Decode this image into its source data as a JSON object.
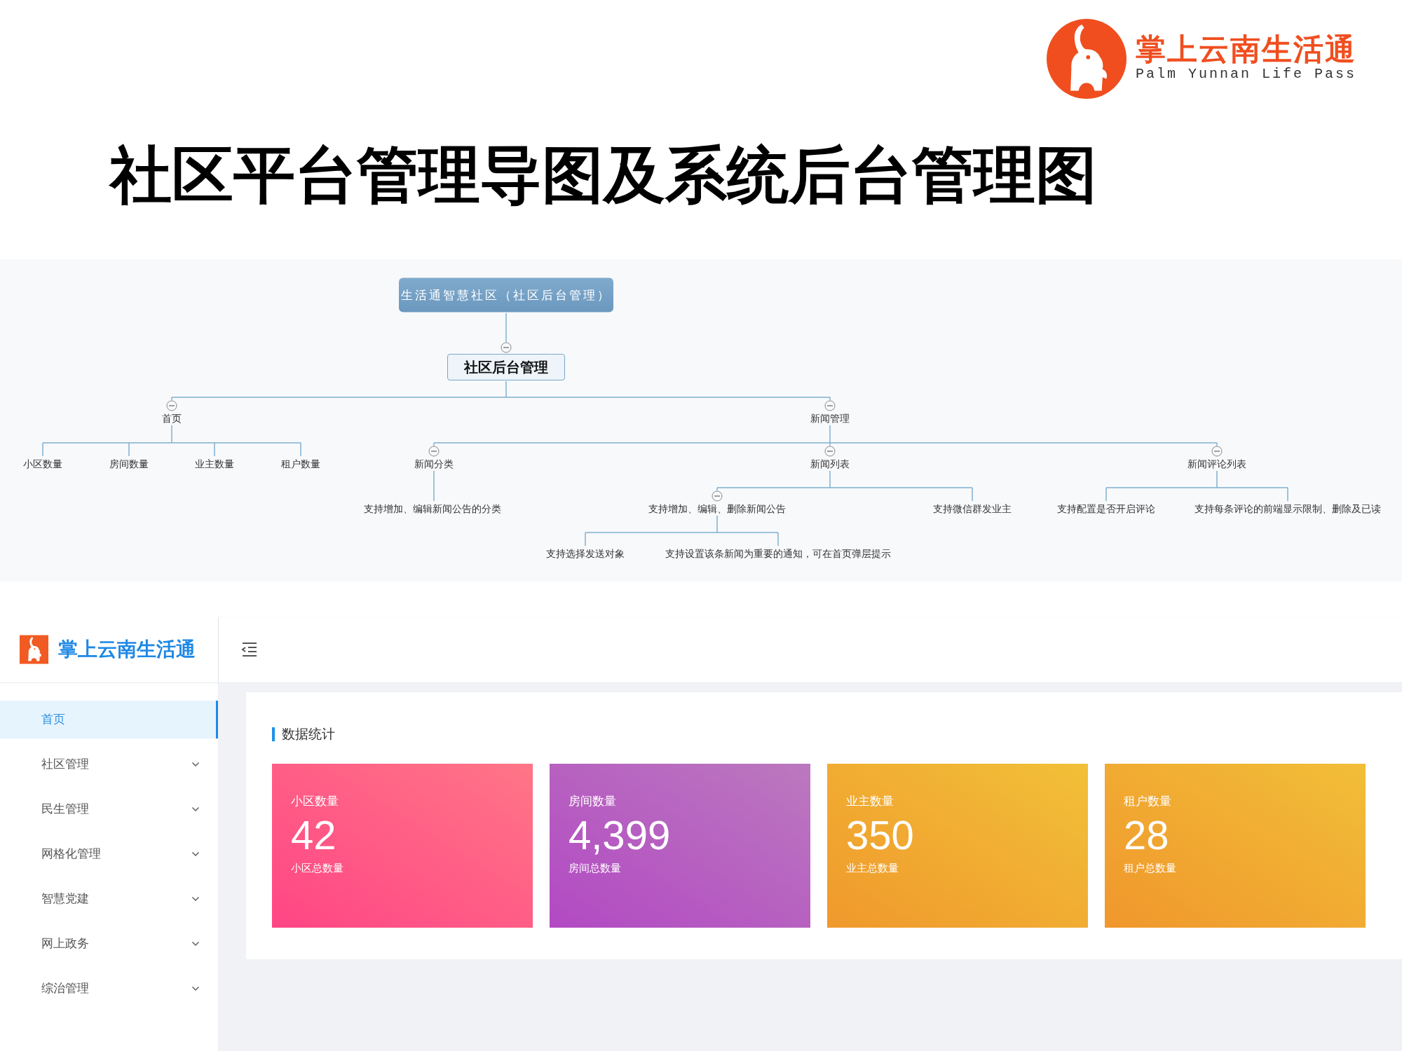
{
  "slide": {
    "title": "社区平台管理导图及系统后台管理图",
    "logo": {
      "name": "掌上云南生活通",
      "tagline": "Palm Yunnan Life Pass"
    }
  },
  "mind_map": {
    "root": {
      "label": "生活通智慧社区（社区后台管理）",
      "children": [
        {
          "label": "社区后台管理",
          "expanded": true,
          "children": [
            {
              "label": "首页",
              "expanded": true,
              "children": [
                {
                  "label": "小区数量"
                },
                {
                  "label": "房间数量"
                },
                {
                  "label": "业主数量"
                },
                {
                  "label": "租户数量"
                }
              ]
            },
            {
              "label": "新闻管理",
              "expanded": true,
              "children": [
                {
                  "label": "新闻分类",
                  "expanded": true,
                  "children": [
                    {
                      "label": "支持增加、编辑新闻公告的分类"
                    }
                  ]
                },
                {
                  "label": "新闻列表",
                  "expanded": true,
                  "children": [
                    {
                      "label": "支持增加、编辑、删除新闻公告",
                      "expanded": true,
                      "children": [
                        {
                          "label": "支持选择发送对象"
                        },
                        {
                          "label": "支持设置该条新闻为重要的通知，可在首页弹层提示"
                        }
                      ]
                    },
                    {
                      "label": "支持微信群发业主"
                    }
                  ]
                },
                {
                  "label": "新闻评论列表",
                  "expanded": true,
                  "children": [
                    {
                      "label": "支持配置是否开启评论"
                    },
                    {
                      "label": "支持每条评论的前端显示限制、删除及已读"
                    }
                  ]
                }
              ]
            }
          ]
        }
      ]
    }
  },
  "admin": {
    "brand": "掌上云南生活通",
    "menu": [
      {
        "label": "首页",
        "selected": true,
        "has_submenu": false
      },
      {
        "label": "社区管理",
        "selected": false,
        "has_submenu": true
      },
      {
        "label": "民生管理",
        "selected": false,
        "has_submenu": true
      },
      {
        "label": "网格化管理",
        "selected": false,
        "has_submenu": true
      },
      {
        "label": "智慧党建",
        "selected": false,
        "has_submenu": true
      },
      {
        "label": "网上政务",
        "selected": false,
        "has_submenu": true
      },
      {
        "label": "综治管理",
        "selected": false,
        "has_submenu": true
      }
    ],
    "section_title": "数据统计",
    "cards": [
      {
        "label": "小区数量",
        "value": "42",
        "caption": "小区总数量",
        "color": "#ff4f8b"
      },
      {
        "label": "房间数量",
        "value": "4,399",
        "caption": "房间总数量",
        "color": "#a853d2"
      },
      {
        "label": "业主数量",
        "value": "350",
        "caption": "业主总数量",
        "color": "#eeae26"
      },
      {
        "label": "租户数量",
        "value": "28",
        "caption": "租户总数量",
        "color": "#eeac26"
      }
    ]
  }
}
